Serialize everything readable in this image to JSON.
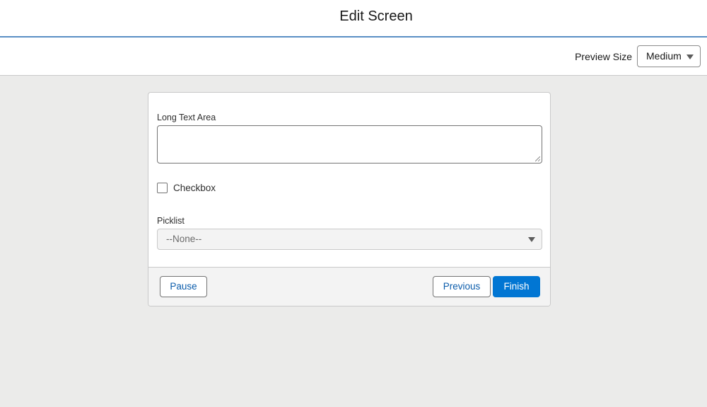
{
  "header": {
    "title": "Edit Screen"
  },
  "toolbar": {
    "preview_label": "Preview Size",
    "preview_select_value": "Medium"
  },
  "form": {
    "long_text_area_label": "Long Text Area",
    "long_text_area_value": "",
    "checkbox_label": "Checkbox",
    "checkbox_checked": false,
    "picklist_label": "Picklist",
    "picklist_value": "--None--"
  },
  "footer": {
    "pause_label": "Pause",
    "previous_label": "Previous",
    "finish_label": "Finish"
  },
  "colors": {
    "brand": "#0176d3",
    "neutral_button_text": "#0b5cab",
    "canvas_background": "#ebebea",
    "header_rule": "#5a8fc5"
  },
  "icons": {
    "preview_select_caret": "caret-down-icon",
    "picklist_caret": "caret-down-icon",
    "textarea_grip": "resize-grip-icon"
  }
}
